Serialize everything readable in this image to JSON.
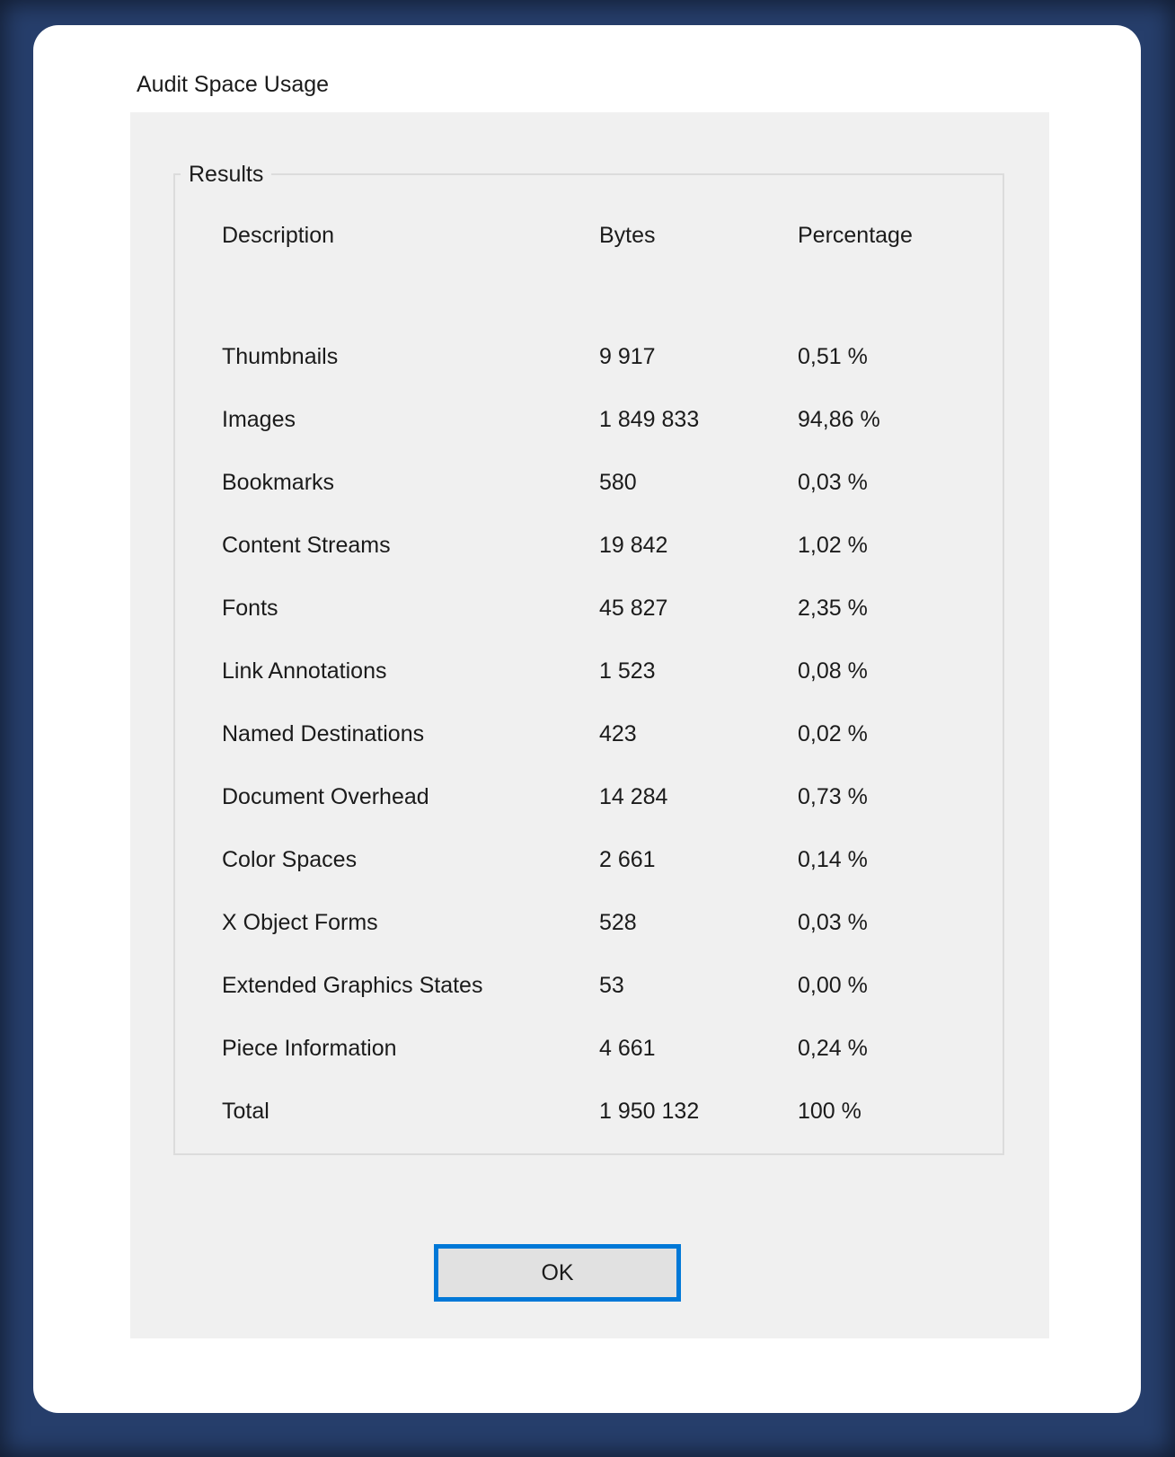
{
  "window": {
    "title": "Audit Space Usage"
  },
  "results_group": {
    "label": "Results"
  },
  "table": {
    "headers": {
      "description": "Description",
      "bytes": "Bytes",
      "percentage": "Percentage"
    },
    "rows": [
      {
        "description": "Thumbnails",
        "bytes": "9 917",
        "percentage": "0,51 %"
      },
      {
        "description": "Images",
        "bytes": "1 849 833",
        "percentage": "94,86 %"
      },
      {
        "description": "Bookmarks",
        "bytes": "580",
        "percentage": "0,03 %"
      },
      {
        "description": "Content Streams",
        "bytes": "19 842",
        "percentage": "1,02 %"
      },
      {
        "description": "Fonts",
        "bytes": "45 827",
        "percentage": "2,35 %"
      },
      {
        "description": "Link Annotations",
        "bytes": "1 523",
        "percentage": "0,08 %"
      },
      {
        "description": "Named Destinations",
        "bytes": "423",
        "percentage": "0,02 %"
      },
      {
        "description": "Document Overhead",
        "bytes": "14 284",
        "percentage": "0,73 %"
      },
      {
        "description": "Color Spaces",
        "bytes": "2 661",
        "percentage": "0,14 %"
      },
      {
        "description": "X Object Forms",
        "bytes": "528",
        "percentage": "0,03 %"
      },
      {
        "description": "Extended Graphics States",
        "bytes": "53",
        "percentage": "0,00 %"
      },
      {
        "description": "Piece Information",
        "bytes": "4 661",
        "percentage": "0,24 %"
      },
      {
        "description": "Total",
        "bytes": "1 950 132",
        "percentage": "100 %"
      }
    ]
  },
  "buttons": {
    "ok": "OK"
  },
  "colors": {
    "frame_background": "#263e6b",
    "window_background": "#ffffff",
    "panel_background": "#f0f0f0",
    "groupbox_border": "#dcdcdc",
    "accent_border": "#0078d7",
    "button_face": "#e1e1e1",
    "text": "#1b1b1b"
  }
}
